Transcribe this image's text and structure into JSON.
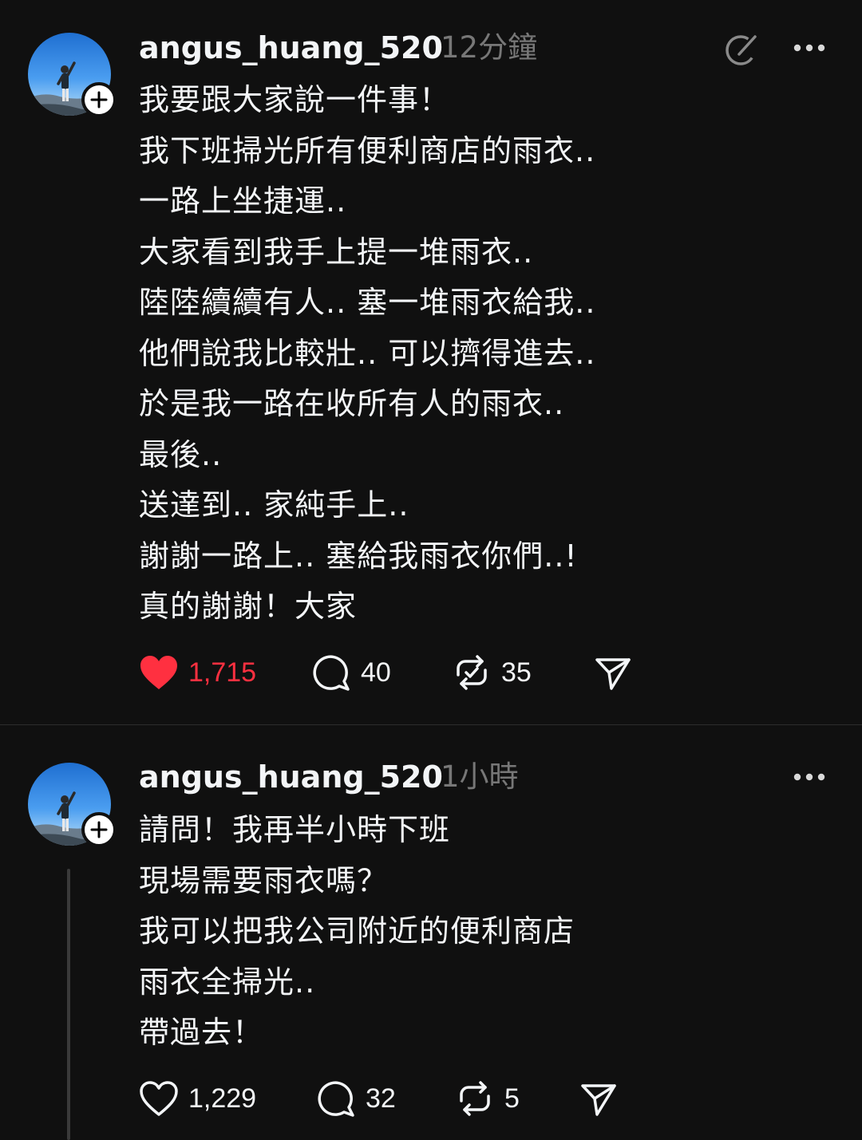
{
  "colors": {
    "background": "#101010",
    "text": "#f3f5f7",
    "muted": "#777777",
    "like_active": "#ff3040",
    "divider": "#2d2d2d"
  },
  "posts": [
    {
      "username": "angus_huang_520",
      "time": "12分鐘",
      "lines": [
        "我要跟大家說一件事！",
        "我下班掃光所有便利商店的雨衣..",
        "一路上坐捷運..",
        "大家看到我手上提一堆雨衣..",
        "陸陸續續有人.. 塞一堆雨衣給我..",
        "他們說我比較壯.. 可以擠得進去..",
        "於是我一路在收所有人的雨衣..",
        "最後..",
        "送達到.. 家純手上..",
        "謝謝一路上.. 塞給我雨衣你們..!",
        "真的謝謝！大家"
      ],
      "likes": "1,715",
      "liked": true,
      "replies": "40",
      "reposts": "35",
      "icons": [
        "heart-filled-icon",
        "comment-icon",
        "repost-icon",
        "share-icon",
        "edit-icon",
        "more-icon"
      ]
    },
    {
      "username": "angus_huang_520",
      "time": "1小時",
      "lines": [
        "請問！我再半小時下班",
        "現場需要雨衣嗎？",
        "我可以把我公司附近的便利商店",
        "雨衣全掃光..",
        "帶過去！"
      ],
      "likes": "1,229",
      "liked": false,
      "replies": "32",
      "reposts": "5",
      "icons": [
        "heart-icon",
        "comment-icon",
        "repost-icon",
        "share-icon",
        "more-icon"
      ]
    }
  ]
}
